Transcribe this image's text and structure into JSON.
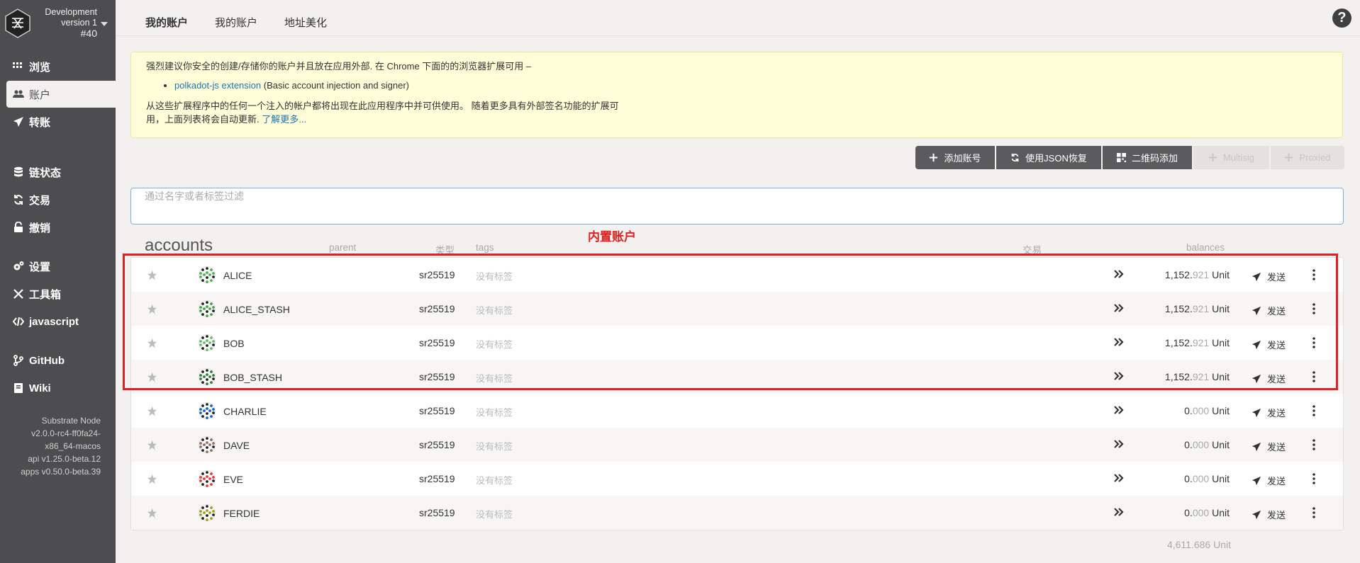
{
  "chain": {
    "name": "Development",
    "version": "version 1",
    "number": "#40"
  },
  "sidebar": {
    "items": [
      {
        "label": "浏览",
        "icon": "th-icon"
      },
      {
        "label": "账户",
        "icon": "users-icon"
      },
      {
        "label": "转账",
        "icon": "send-icon"
      },
      {
        "label": "链状态",
        "icon": "database-icon"
      },
      {
        "label": "交易",
        "icon": "sync-icon"
      },
      {
        "label": "撤销",
        "icon": "unlock-icon"
      },
      {
        "label": "设置",
        "icon": "cogs-icon"
      },
      {
        "label": "工具箱",
        "icon": "tools-icon"
      },
      {
        "label": "javascript",
        "icon": "code-icon"
      },
      {
        "label": "GitHub",
        "icon": "github-icon"
      },
      {
        "label": "Wiki",
        "icon": "book-icon"
      }
    ],
    "version_lines": [
      "Substrate Node",
      "v2.0.0-rc4-ff0fa24-",
      "x86_64-macos",
      "api v1.25.0-beta.12",
      "apps v0.50.0-beta.39"
    ]
  },
  "tabs": [
    "我的账户",
    "我的账户",
    "地址美化"
  ],
  "help": "?",
  "notice": {
    "line1": "强烈建议你安全的创建/存储你的账户并且放在应用外部. 在 Chrome 下面的的浏览器扩展可用 –",
    "ext_link": "polkadot-js extension",
    "ext_desc": " (Basic account injection and signer)",
    "line2a": "从这些扩展程序中的任何一个注入的帐户都将出现在此应用程序中并可供使用。 随着更多具有外部签名功能的扩展可",
    "line2b": "用，上面列表将会自动更新. ",
    "learn_more": "了解更多..."
  },
  "buttons": {
    "add": "添加账号",
    "restore": "使用JSON恢复",
    "qr": "二维码添加",
    "multisig": "Multisig",
    "proxied": "Proxied"
  },
  "filter": {
    "placeholder": "通过名字或者标签过滤"
  },
  "headers": {
    "accounts": "accounts",
    "parent": "parent",
    "type": "类型",
    "tags": "tags",
    "transactions": "交易",
    "balances": "balances"
  },
  "annotation": "内置账户",
  "accounts": [
    {
      "name": "ALICE",
      "type": "sr25519",
      "tags": "没有标签",
      "bal_int": "1,152.",
      "bal_dec": "921",
      "unit": " Unit",
      "send": "发送"
    },
    {
      "name": "ALICE_STASH",
      "type": "sr25519",
      "tags": "没有标签",
      "bal_int": "1,152.",
      "bal_dec": "921",
      "unit": " Unit",
      "send": "发送"
    },
    {
      "name": "BOB",
      "type": "sr25519",
      "tags": "没有标签",
      "bal_int": "1,152.",
      "bal_dec": "921",
      "unit": " Unit",
      "send": "发送"
    },
    {
      "name": "BOB_STASH",
      "type": "sr25519",
      "tags": "没有标签",
      "bal_int": "1,152.",
      "bal_dec": "921",
      "unit": " Unit",
      "send": "发送"
    },
    {
      "name": "CHARLIE",
      "type": "sr25519",
      "tags": "没有标签",
      "bal_int": "0.",
      "bal_dec": "000",
      "unit": " Unit",
      "send": "发送"
    },
    {
      "name": "DAVE",
      "type": "sr25519",
      "tags": "没有标签",
      "bal_int": "0.",
      "bal_dec": "000",
      "unit": " Unit",
      "send": "发送"
    },
    {
      "name": "EVE",
      "type": "sr25519",
      "tags": "没有标签",
      "bal_int": "0.",
      "bal_dec": "000",
      "unit": " Unit",
      "send": "发送"
    },
    {
      "name": "FERDIE",
      "type": "sr25519",
      "tags": "没有标签",
      "bal_int": "0.",
      "bal_dec": "000",
      "unit": " Unit",
      "send": "发送"
    }
  ],
  "total": "4,611.686 Unit",
  "colors": {
    "sidebar": "#4d4d4f",
    "accent": "#1f74b0",
    "highlight": "#dd2222",
    "notice": "#fffed9"
  }
}
